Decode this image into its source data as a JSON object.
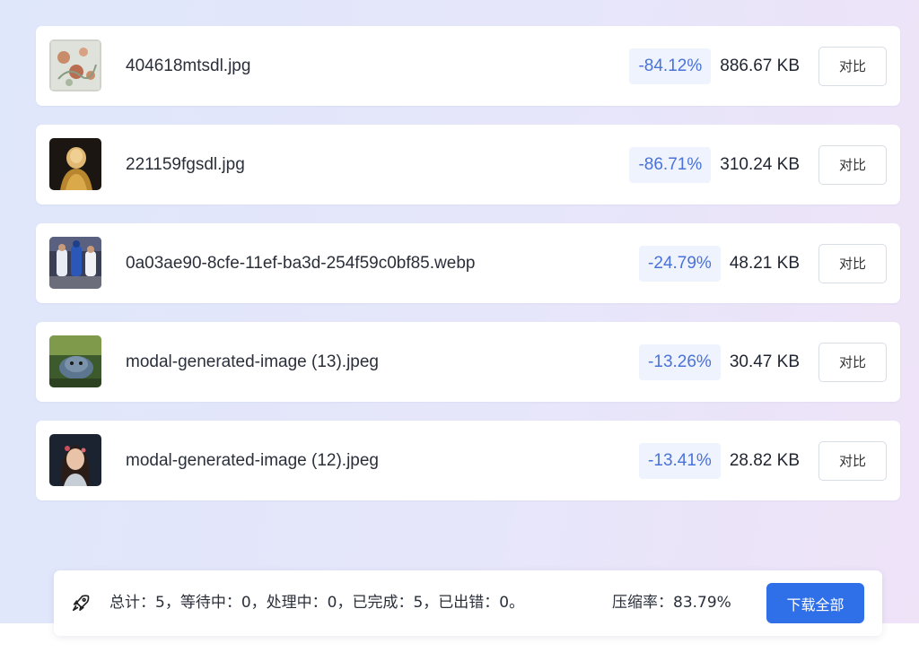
{
  "files": [
    {
      "name": "404618mtsdl.jpg",
      "ratio": "-84.12%",
      "size": "886.67 KB",
      "compare_label": "对比",
      "thumb_icon": "floral-painting-thumbnail"
    },
    {
      "name": "221159fgsdl.jpg",
      "ratio": "-86.71%",
      "size": "310.24 KB",
      "compare_label": "对比",
      "thumb_icon": "golden-portrait-thumbnail"
    },
    {
      "name": "0a03ae90-8cfe-11ef-ba3d-254f59c0bf85.webp",
      "ratio": "-24.79%",
      "size": "48.21 KB",
      "compare_label": "对比",
      "thumb_icon": "baseball-photo-thumbnail"
    },
    {
      "name": "modal-generated-image (13).jpeg",
      "ratio": "-13.26%",
      "size": "30.47 KB",
      "compare_label": "对比",
      "thumb_icon": "creature-art-thumbnail"
    },
    {
      "name": "modal-generated-image (12).jpeg",
      "ratio": "-13.41%",
      "size": "28.82 KB",
      "compare_label": "对比",
      "thumb_icon": "woman-portrait-thumbnail"
    }
  ],
  "status": {
    "icon": "rocket-icon",
    "summary": "总计：5，等待中：0，处理中：0，已完成：5，已出错：0。",
    "compression_ratio": "压缩率：83.79%",
    "download_all_label": "下载全部"
  },
  "colors": {
    "accent": "#2f6fe8",
    "ratio_text": "#4a72d9",
    "ratio_bg": "#eef3fd"
  }
}
